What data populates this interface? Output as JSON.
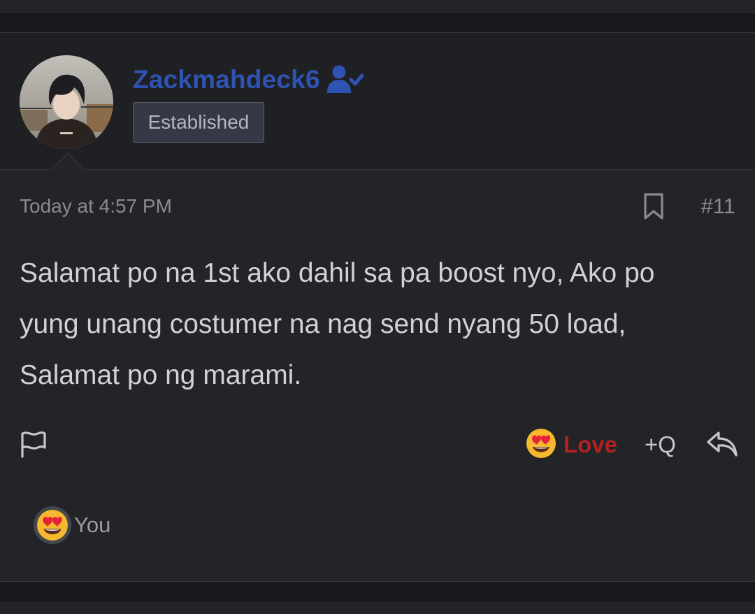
{
  "post": {
    "username": "Zackmahdeck6",
    "user_title": "Established",
    "timestamp": "Today at 4:57 PM",
    "post_number": "#11",
    "message_lines": [
      "Salamat po na 1st ako dahil sa pa boost nyo, Ako po",
      "yung unang costumer na nag send nyang 50 load,",
      "Salamat po ng marami."
    ]
  },
  "actions": {
    "reaction_label": "Love",
    "quote_label": "+Q"
  },
  "reactions": {
    "reactor": "You"
  },
  "icons": {
    "verified": "user-check-icon",
    "bookmark": "bookmark-icon",
    "report": "flag-icon",
    "reaction": "heart-eyes-emoji-icon",
    "reply": "reply-icon"
  },
  "colors": {
    "page_bg": "#17181c",
    "post_bg": "#232428",
    "header_bg": "#1f2024",
    "username": "#2f53b3",
    "love": "#b32121",
    "body_text": "#d2d2d6",
    "muted_text": "#8a8b91"
  }
}
